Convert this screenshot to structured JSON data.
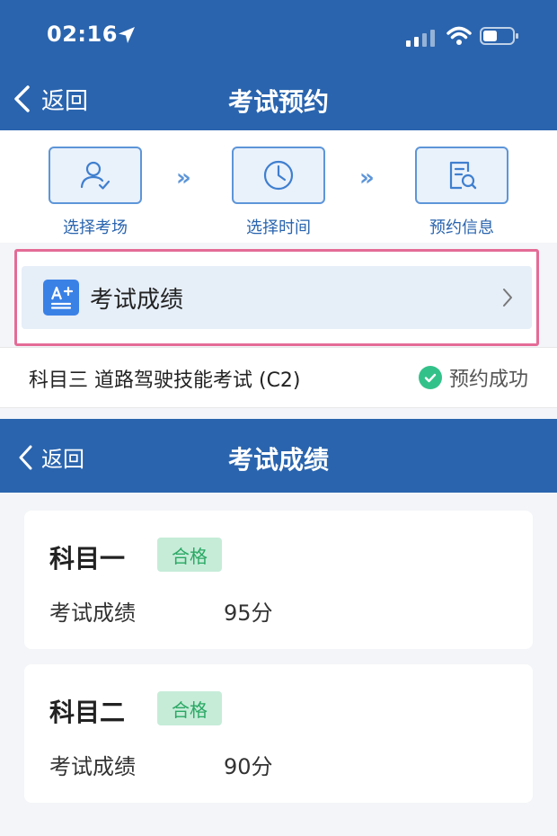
{
  "status_bar": {
    "time": "02:16"
  },
  "reservation_page": {
    "back_label": "返回",
    "title": "考试预约",
    "steps": [
      {
        "label": "选择考场",
        "icon": "person-check-icon"
      },
      {
        "label": "选择时间",
        "icon": "clock-icon"
      },
      {
        "label": "预约信息",
        "icon": "document-search-icon"
      }
    ],
    "step_separator": "»",
    "score_entry": {
      "label": "考试成绩",
      "icon": "a-plus-icon"
    },
    "exam": {
      "name": "科目三 道路驾驶技能考试 (C2)",
      "status": "预约成功"
    }
  },
  "scores_page": {
    "back_label": "返回",
    "title": "考试成绩",
    "results": [
      {
        "subject": "科目一",
        "badge": "合格",
        "score_label": "考试成绩",
        "score": "95分"
      },
      {
        "subject": "科目二",
        "badge": "合格",
        "score_label": "考试成绩",
        "score": "90分"
      }
    ]
  },
  "colors": {
    "primary": "#2a64ae",
    "highlight": "#e46b96",
    "success": "#33c18a",
    "badge_bg": "#c6ecd8"
  }
}
